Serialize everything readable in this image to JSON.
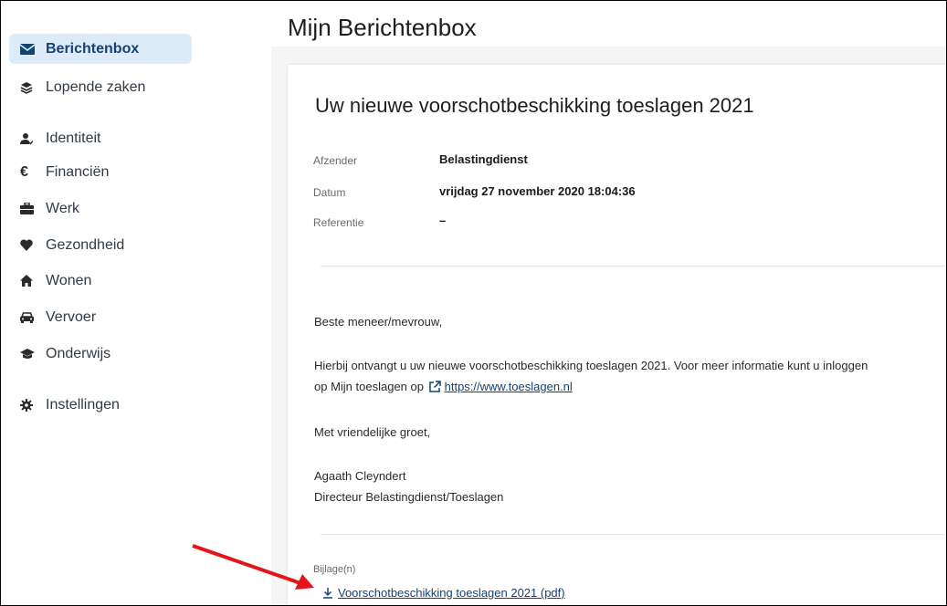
{
  "page_title": "Mijn Berichtenbox",
  "sidebar": {
    "items": [
      {
        "label": "Berichtenbox",
        "icon": "envelope-icon",
        "active": true
      },
      {
        "label": "Lopende zaken",
        "icon": "layers-icon"
      },
      {
        "label": "Identiteit",
        "icon": "person-check-icon"
      },
      {
        "label": "Financiën",
        "icon": "euro-icon"
      },
      {
        "label": "Werk",
        "icon": "briefcase-icon"
      },
      {
        "label": "Gezondheid",
        "icon": "heart-icon"
      },
      {
        "label": "Wonen",
        "icon": "home-icon"
      },
      {
        "label": "Vervoer",
        "icon": "car-icon"
      },
      {
        "label": "Onderwijs",
        "icon": "graduation-cap-icon"
      },
      {
        "label": "Instellingen",
        "icon": "gear-icon"
      }
    ]
  },
  "message": {
    "title": "Uw nieuwe voorschotbeschikking toeslagen 2021",
    "meta": {
      "sender_label": "Afzender",
      "sender_value": "Belastingdienst",
      "date_label": "Datum",
      "date_value": "vrijdag 27 november 2020 18:04:36",
      "reference_label": "Referentie",
      "reference_value": "–"
    },
    "body": {
      "greeting": "Beste meneer/mevrouw,",
      "line1": "Hierbij ontvangt u uw nieuwe voorschotbeschikking toeslagen 2021. Voor meer informatie kunt u inloggen",
      "line2_prefix": "op Mijn toeslagen op",
      "link": "https://www.toeslagen.nl",
      "closing": "Met vriendelijke groet,",
      "signer_name": "Agaath Cleyndert",
      "signer_title": "Directeur Belastingdienst/Toeslagen"
    },
    "attachments": {
      "label": "Bijlage(n)",
      "file": "Voorschotbeschikking toeslagen 2021 (pdf)"
    }
  },
  "colors": {
    "accent": "#154273",
    "active_bg": "#dcebf7",
    "arrow": "#e4141b"
  }
}
